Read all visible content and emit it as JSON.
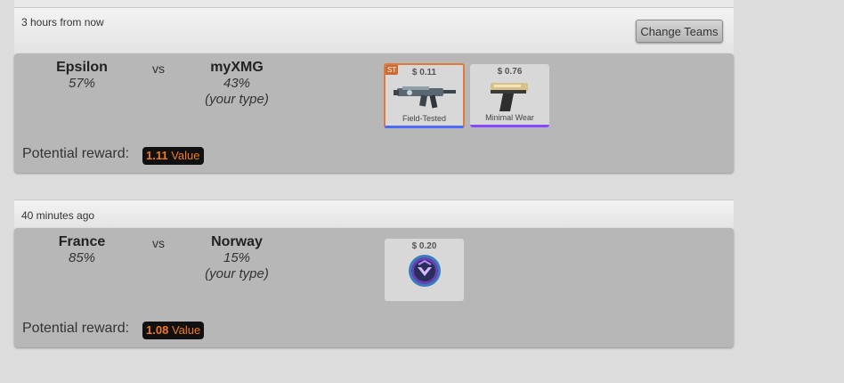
{
  "colors": {
    "page_bg": "#dcdcdc",
    "card_bg": "#b7b7b7",
    "reward_text": "#f07a1a",
    "stattrak_orange": "#cf6a32",
    "rarity_blue": "#4b69ff",
    "rarity_purple": "#8847ff"
  },
  "matches": [
    {
      "time": "3 hours from now",
      "change_teams_label": "Change Teams",
      "team1": {
        "name": "Epsilon",
        "pct": "57%"
      },
      "vs_label": "vs",
      "team2": {
        "name": "myXMG",
        "pct": "43%",
        "note": "(your type)"
      },
      "reward_label": "Potential reward:",
      "reward_value": "1.11",
      "reward_unit": "Value",
      "items": [
        {
          "price": "$ 0.11",
          "wear": "Field-Tested",
          "badge": "ST",
          "icon": "smg-icon",
          "rarity_color": "#4b69ff"
        },
        {
          "price": "$ 0.76",
          "wear": "Minimal Wear",
          "icon": "pistol-icon",
          "rarity_color": "#8847ff"
        }
      ]
    },
    {
      "time": "40 minutes ago",
      "team1": {
        "name": "France",
        "pct": "85%"
      },
      "vs_label": "vs",
      "team2": {
        "name": "Norway",
        "pct": "15%",
        "note": "(your type)"
      },
      "reward_label": "Potential reward:",
      "reward_value": "1.08",
      "reward_unit": "Value",
      "items": [
        {
          "price": "$ 0.20",
          "icon": "case-key-icon"
        }
      ]
    }
  ]
}
